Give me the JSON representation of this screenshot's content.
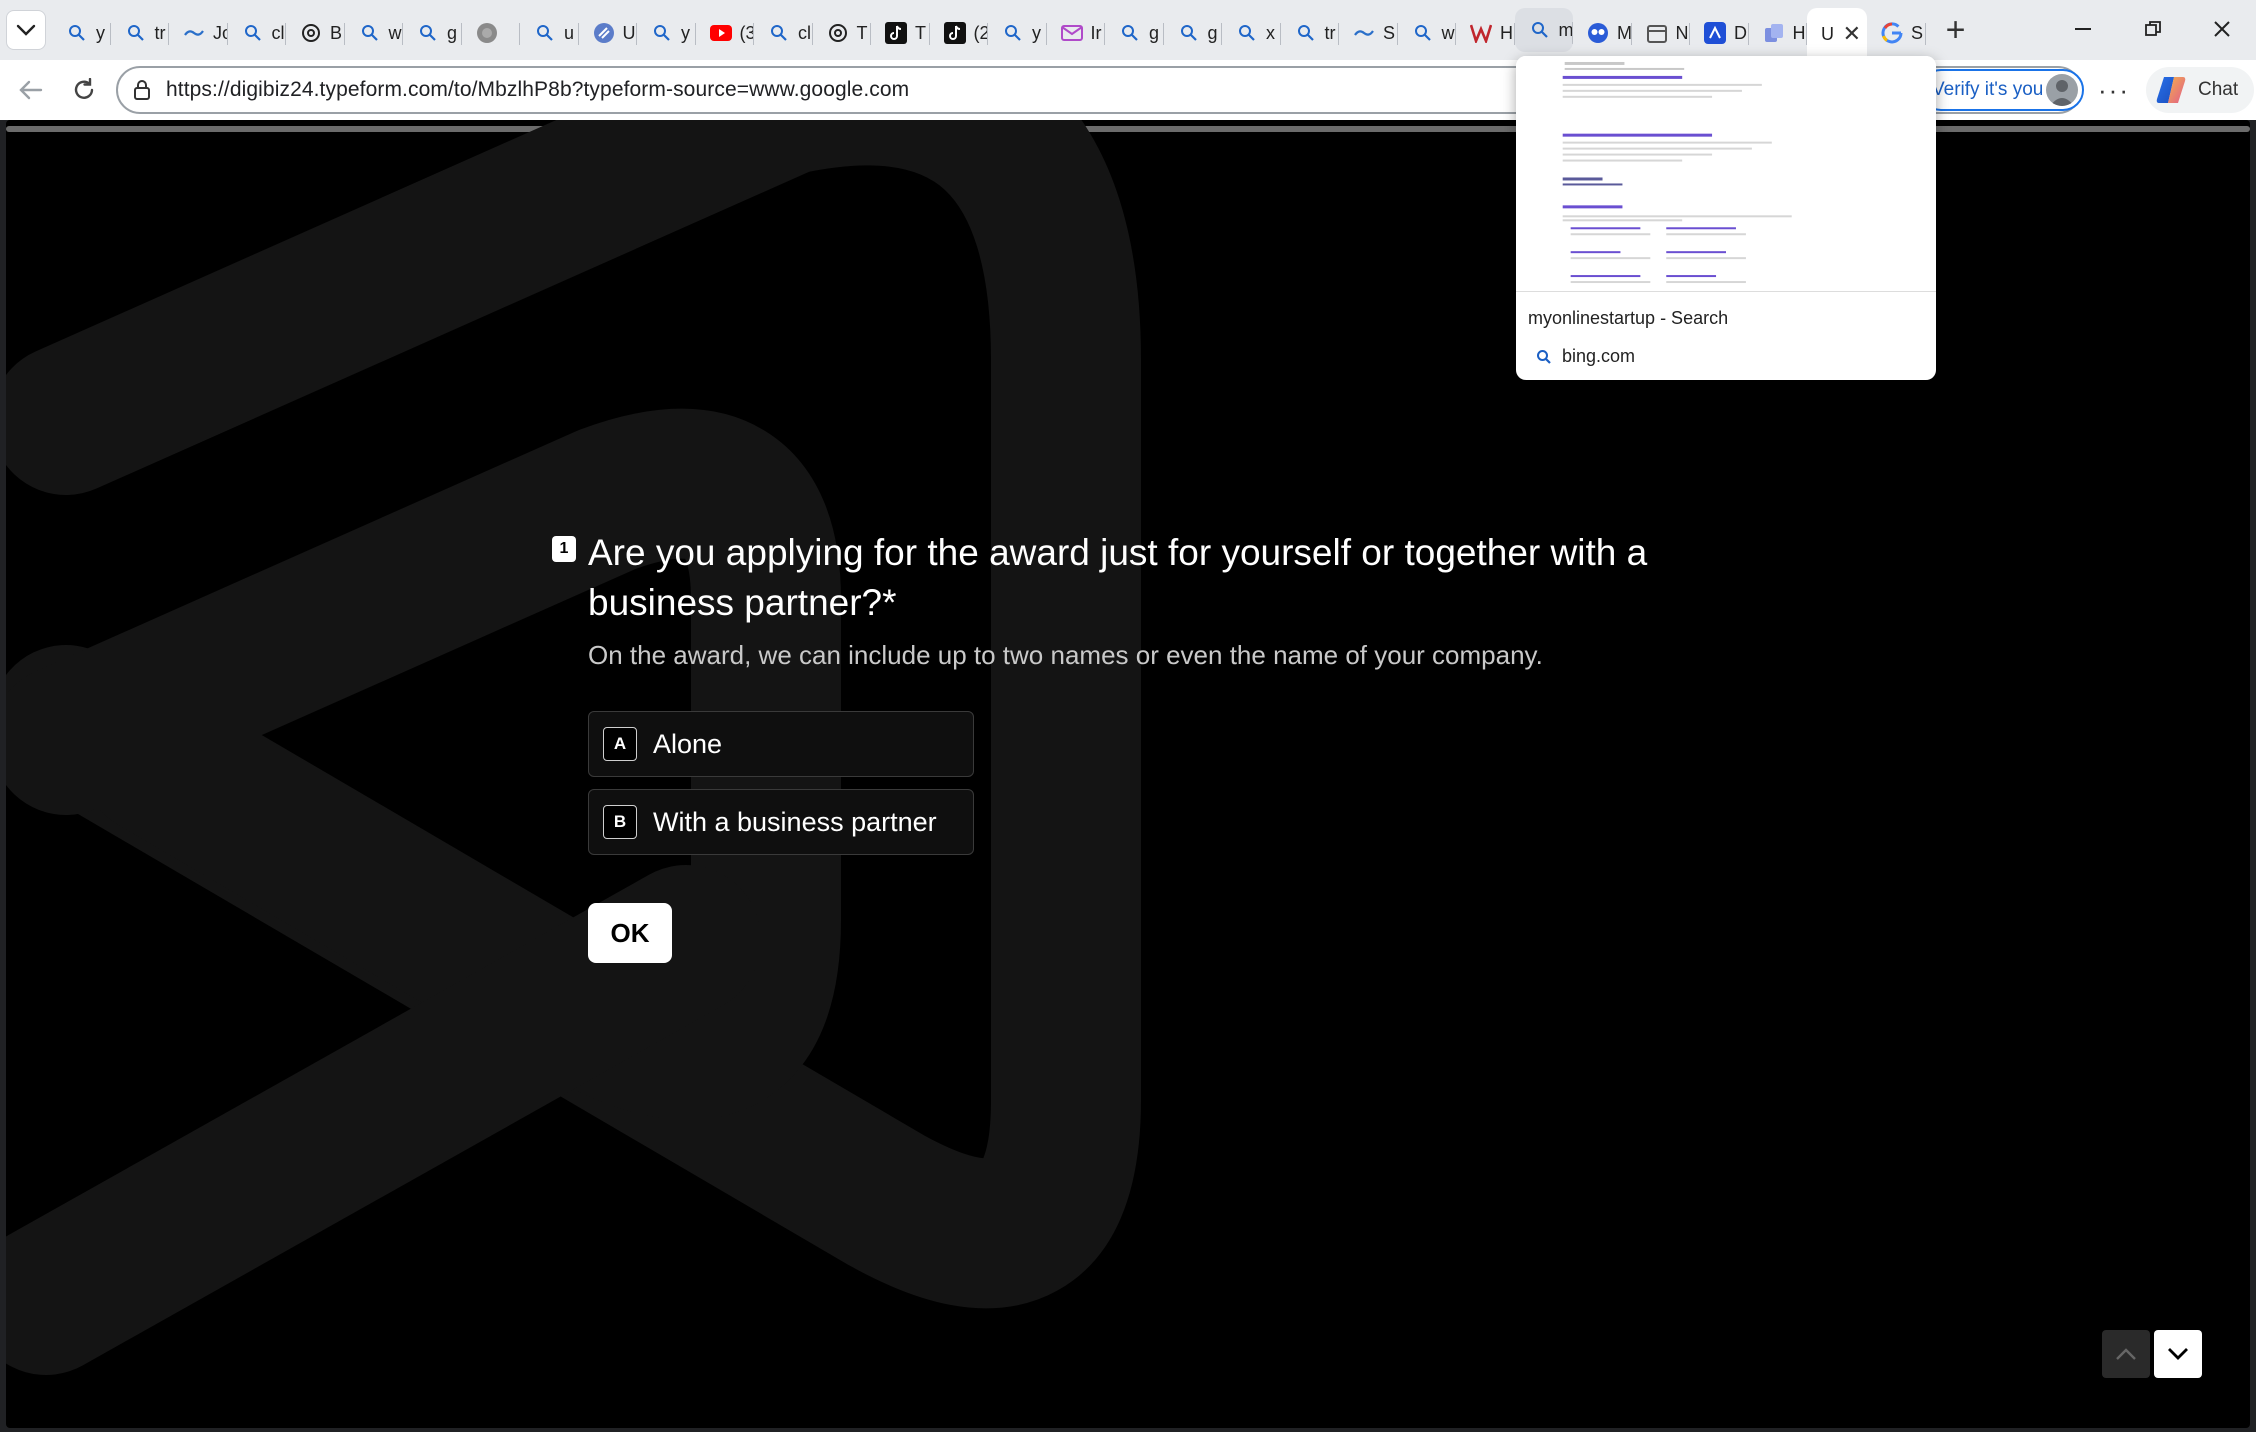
{
  "browser": {
    "tabs": [
      {
        "icon": "search-icon",
        "label": "y"
      },
      {
        "icon": "search-icon",
        "label": "tr"
      },
      {
        "icon": "tilde-icon",
        "label": "Jo"
      },
      {
        "icon": "search-icon",
        "label": "cl"
      },
      {
        "icon": "openai-icon",
        "label": "B"
      },
      {
        "icon": "search-icon",
        "label": "w"
      },
      {
        "icon": "search-icon",
        "label": "g"
      },
      {
        "icon": "circle-icon",
        "label": ""
      },
      {
        "icon": "search-icon",
        "label": "u"
      },
      {
        "icon": "u-logo-icon",
        "label": "U"
      },
      {
        "icon": "search-icon",
        "label": "y"
      },
      {
        "icon": "youtube-icon",
        "label": "(3"
      },
      {
        "icon": "search-icon",
        "label": "cl"
      },
      {
        "icon": "openai-icon",
        "label": "T"
      },
      {
        "icon": "tiktok-icon",
        "label": "T"
      },
      {
        "icon": "tiktok-icon",
        "label": "(2"
      },
      {
        "icon": "search-icon",
        "label": "y"
      },
      {
        "icon": "mail-icon",
        "label": "Ir"
      },
      {
        "icon": "search-icon",
        "label": "g"
      },
      {
        "icon": "search-icon",
        "label": "g"
      },
      {
        "icon": "search-icon",
        "label": "x"
      },
      {
        "icon": "search-icon",
        "label": "tr"
      },
      {
        "icon": "tilde-icon",
        "label": "S"
      },
      {
        "icon": "search-icon",
        "label": "w"
      },
      {
        "icon": "w-logo-icon",
        "label": "H"
      },
      {
        "icon": "search-icon",
        "label": "m"
      },
      {
        "icon": "owl-icon",
        "label": "M"
      },
      {
        "icon": "calendar-icon",
        "label": "N"
      },
      {
        "icon": "blue-app-icon",
        "label": "D"
      },
      {
        "icon": "copy-icon",
        "label": "H"
      },
      {
        "icon": "",
        "label": "U"
      },
      {
        "icon": "google-icon",
        "label": "S"
      }
    ],
    "url": "https://digibiz24.typeform.com/to/MbzlhP8b?typeform-source=www.google.com",
    "verify_label": "Verify it's you",
    "chat_label": "Chat",
    "preview": {
      "title": "myonlinestartup - Search",
      "domain": "bing.com"
    }
  },
  "form": {
    "question_number": "1",
    "question_title": "Are you applying for the award just for yourself or together with a business partner?*",
    "question_description": "On the award, we can include up to two names or even the name of your company.",
    "choices": [
      {
        "key": "A",
        "label": "Alone"
      },
      {
        "key": "B",
        "label": "With a business partner"
      }
    ],
    "ok_label": "OK"
  },
  "colors": {
    "page_background": "#000000",
    "accent": "#ffffff",
    "verify_border": "#1a73e8"
  }
}
